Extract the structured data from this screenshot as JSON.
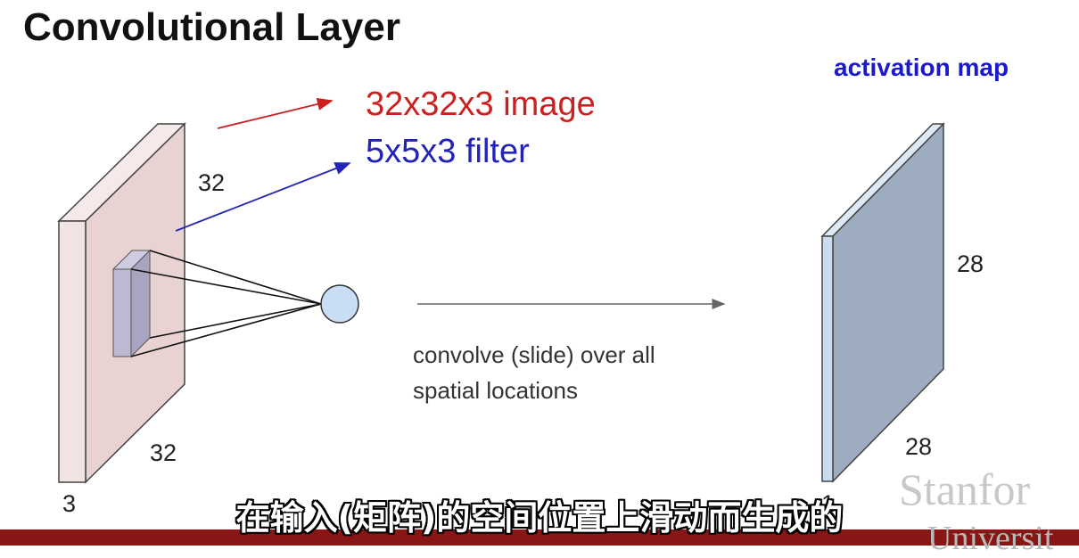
{
  "slide": {
    "title": "Convolutional Layer",
    "activation_label": "activation map",
    "image_label": "32x32x3 image",
    "filter_label": "5x5x3 filter",
    "input_dims": {
      "height": "32",
      "width": "32",
      "depth": "3"
    },
    "output_dims": {
      "height": "28",
      "width": "28",
      "depth": "1"
    },
    "caption_line1": "convolve (slide) over all",
    "caption_line2": "spatial locations"
  },
  "colors": {
    "input_front": "#e8d2d2",
    "input_side": "#f3e4e4",
    "filter": "#b0acc6",
    "neuron": "#c9def5",
    "output_front": "#9eacbf",
    "output_side": "#c9dcf0",
    "image_label": "#cc1f1f",
    "filter_label": "#2323b8",
    "activation_label": "#1a1acc"
  },
  "watermark": {
    "line1": "Stanfor",
    "line2": "Universit"
  },
  "subtitle": "在输入(矩阵)的空间位置上滑动而生成的"
}
